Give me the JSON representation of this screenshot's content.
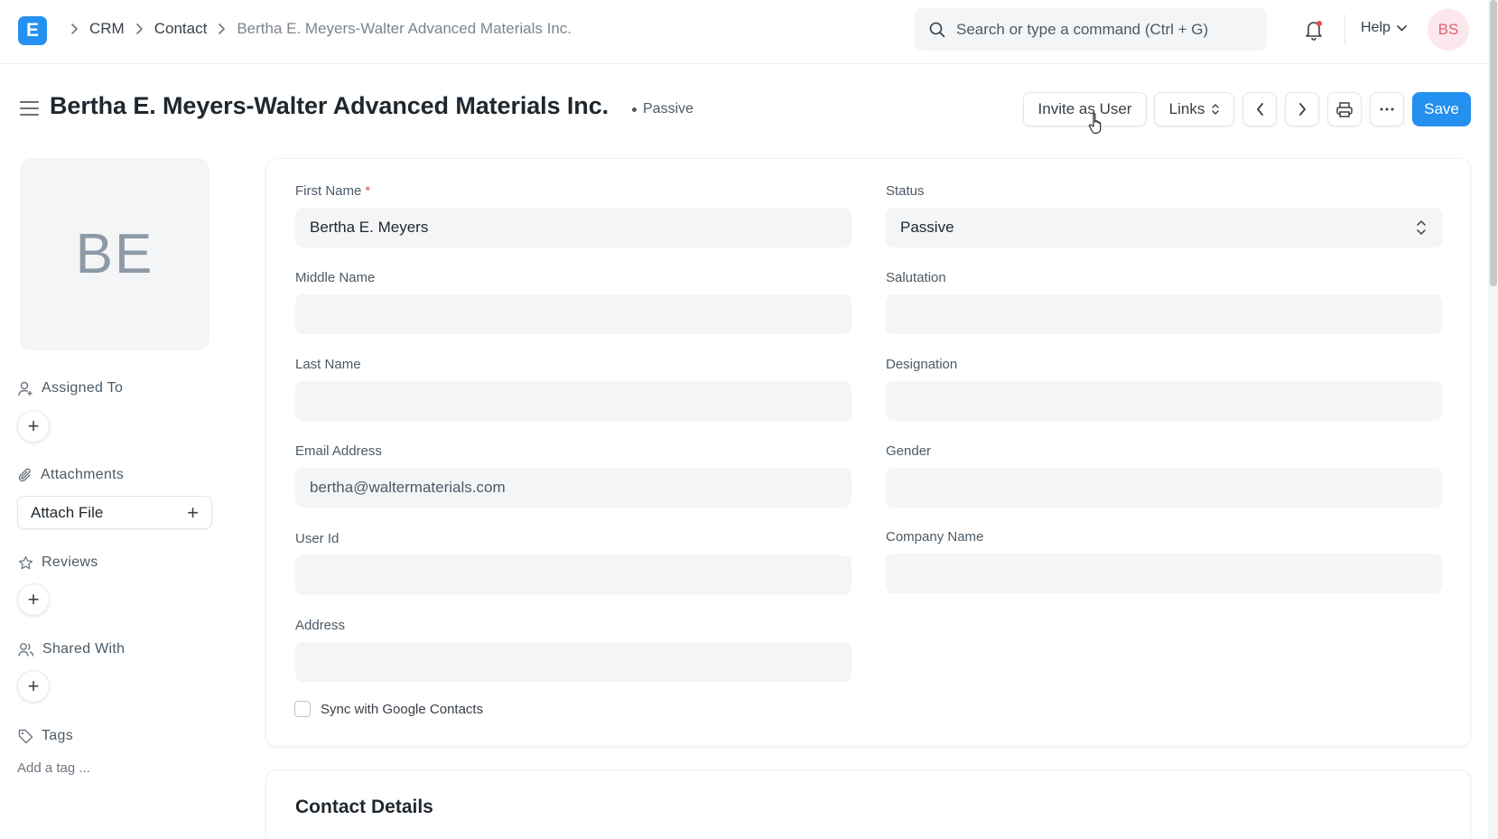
{
  "navbar": {
    "logo_letter": "E",
    "breadcrumbs": [
      "CRM",
      "Contact",
      "Bertha E. Meyers-Walter Advanced Materials Inc."
    ],
    "search_placeholder": "Search or type a command (Ctrl + G)",
    "help_label": "Help",
    "user_initials": "BS"
  },
  "page": {
    "title": "Bertha E. Meyers-Walter Advanced Materials Inc.",
    "status": "Passive"
  },
  "actions": {
    "invite_label": "Invite as User",
    "links_label": "Links",
    "save_label": "Save"
  },
  "sidebar": {
    "avatar_initials": "BE",
    "assigned_to": "Assigned To",
    "attachments": "Attachments",
    "attach_file": "Attach File",
    "reviews": "Reviews",
    "shared_with": "Shared With",
    "tags": "Tags",
    "add_tag": "Add a tag ..."
  },
  "form": {
    "left": [
      {
        "label": "First Name",
        "value": "Bertha E. Meyers",
        "required": true
      },
      {
        "label": "Middle Name",
        "value": ""
      },
      {
        "label": "Last Name",
        "value": ""
      },
      {
        "label": "Email Address",
        "value": "bertha@waltermaterials.com"
      },
      {
        "label": "User Id",
        "value": ""
      },
      {
        "label": "Address",
        "value": ""
      }
    ],
    "right": [
      {
        "label": "Status",
        "value": "Passive"
      },
      {
        "label": "Salutation",
        "value": ""
      },
      {
        "label": "Designation",
        "value": ""
      },
      {
        "label": "Gender",
        "value": ""
      },
      {
        "label": "Company Name",
        "value": ""
      }
    ],
    "sync_label": "Sync with Google Contacts",
    "sync_checked": false
  },
  "contact_details": {
    "title": "Contact Details"
  },
  "colors": {
    "primary": "#2490ef",
    "avatar_bg": "#fce8ec",
    "avatar_text": "#e15d77",
    "required": "#e24c4c"
  }
}
